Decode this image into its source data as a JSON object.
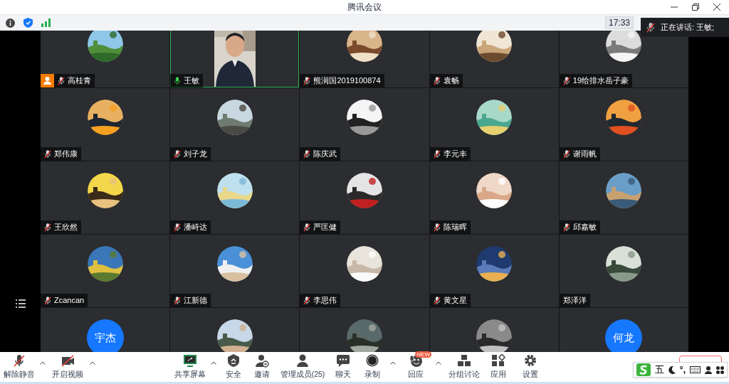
{
  "window": {
    "title": "腾讯会议"
  },
  "status_bar": {
    "time": "17:33"
  },
  "speaking_popup": {
    "text": "正在讲话: 王敏;"
  },
  "participants": [
    {
      "name": "高桂青",
      "mic_icon": true,
      "muted": true,
      "host": true,
      "speaking": false,
      "avatar": {
        "kind": "picture"
      }
    },
    {
      "name": "王敏",
      "mic_icon": true,
      "muted": false,
      "host": false,
      "speaking": true,
      "avatar": {
        "kind": "video"
      }
    },
    {
      "name": "熊润国2019100874",
      "mic_icon": true,
      "muted": true,
      "host": false,
      "speaking": false,
      "avatar": {
        "kind": "picture"
      }
    },
    {
      "name": "袁畅",
      "mic_icon": true,
      "muted": true,
      "host": false,
      "speaking": false,
      "avatar": {
        "kind": "picture"
      }
    },
    {
      "name": "19给排水岳子豪",
      "mic_icon": true,
      "muted": true,
      "host": false,
      "speaking": false,
      "avatar": {
        "kind": "picture"
      }
    },
    {
      "name": "郑伟康",
      "mic_icon": true,
      "muted": true,
      "host": false,
      "speaking": false,
      "avatar": {
        "kind": "picture"
      }
    },
    {
      "name": "刘子龙",
      "mic_icon": true,
      "muted": true,
      "host": false,
      "speaking": false,
      "avatar": {
        "kind": "picture"
      }
    },
    {
      "name": "陈庆武",
      "mic_icon": true,
      "muted": true,
      "host": false,
      "speaking": false,
      "avatar": {
        "kind": "picture"
      }
    },
    {
      "name": "李元丰",
      "mic_icon": true,
      "muted": true,
      "host": false,
      "speaking": false,
      "avatar": {
        "kind": "picture"
      }
    },
    {
      "name": "谢雨帆",
      "mic_icon": true,
      "muted": true,
      "host": false,
      "speaking": false,
      "avatar": {
        "kind": "picture"
      }
    },
    {
      "name": "王欣然",
      "mic_icon": true,
      "muted": true,
      "host": false,
      "speaking": false,
      "avatar": {
        "kind": "picture"
      }
    },
    {
      "name": "潘峙达",
      "mic_icon": true,
      "muted": true,
      "host": false,
      "speaking": false,
      "avatar": {
        "kind": "picture"
      }
    },
    {
      "name": "严匡健",
      "mic_icon": true,
      "muted": true,
      "host": false,
      "speaking": false,
      "avatar": {
        "kind": "picture"
      }
    },
    {
      "name": "陈瑞晖",
      "mic_icon": true,
      "muted": true,
      "host": false,
      "speaking": false,
      "avatar": {
        "kind": "picture"
      }
    },
    {
      "name": "邱嘉敏",
      "mic_icon": true,
      "muted": true,
      "host": false,
      "speaking": false,
      "avatar": {
        "kind": "picture"
      }
    },
    {
      "name": "Zcancan",
      "mic_icon": true,
      "muted": true,
      "host": false,
      "speaking": false,
      "avatar": {
        "kind": "picture"
      }
    },
    {
      "name": "江新德",
      "mic_icon": true,
      "muted": true,
      "host": false,
      "speaking": false,
      "avatar": {
        "kind": "picture"
      }
    },
    {
      "name": "李思伟",
      "mic_icon": true,
      "muted": true,
      "host": false,
      "speaking": false,
      "avatar": {
        "kind": "picture"
      }
    },
    {
      "name": "黄文星",
      "mic_icon": true,
      "muted": true,
      "host": false,
      "speaking": false,
      "avatar": {
        "kind": "picture"
      }
    },
    {
      "name": "郑泽洋",
      "mic_icon": false,
      "host": false,
      "speaking": false,
      "avatar": {
        "kind": "picture"
      }
    },
    {
      "avatar": {
        "kind": "text",
        "text": "宇杰",
        "color": "#1677ff"
      }
    },
    {
      "avatar": {
        "kind": "picture"
      }
    },
    {
      "avatar": {
        "kind": "picture"
      }
    },
    {
      "avatar": {
        "kind": "picture"
      }
    },
    {
      "avatar": {
        "kind": "text",
        "text": "何龙",
        "color": "#1677ff"
      }
    }
  ],
  "toolbar": [
    {
      "kind": "mic",
      "label": "解除静音",
      "caret": true
    },
    {
      "kind": "video",
      "label": "开启视频",
      "caret": true
    },
    {
      "kind": "share",
      "label": "共享屏幕",
      "caret": true
    },
    {
      "kind": "security",
      "label": "安全",
      "caret": false
    },
    {
      "kind": "invite",
      "label": "邀请",
      "caret": false
    },
    {
      "kind": "members",
      "label": "管理成员(25)",
      "caret": false
    },
    {
      "kind": "chat",
      "label": "聊天",
      "caret": false
    },
    {
      "kind": "record",
      "label": "录制",
      "caret": true
    },
    {
      "kind": "react",
      "label": "回应",
      "caret": true,
      "badge": "NEW"
    },
    {
      "kind": "breakout",
      "label": "分组讨论",
      "caret": false
    },
    {
      "kind": "apps",
      "label": "应用",
      "caret": false
    },
    {
      "kind": "settings",
      "label": "设置",
      "caret": false
    }
  ],
  "ime_bar": {
    "mode": "五",
    "punct": "°,"
  }
}
